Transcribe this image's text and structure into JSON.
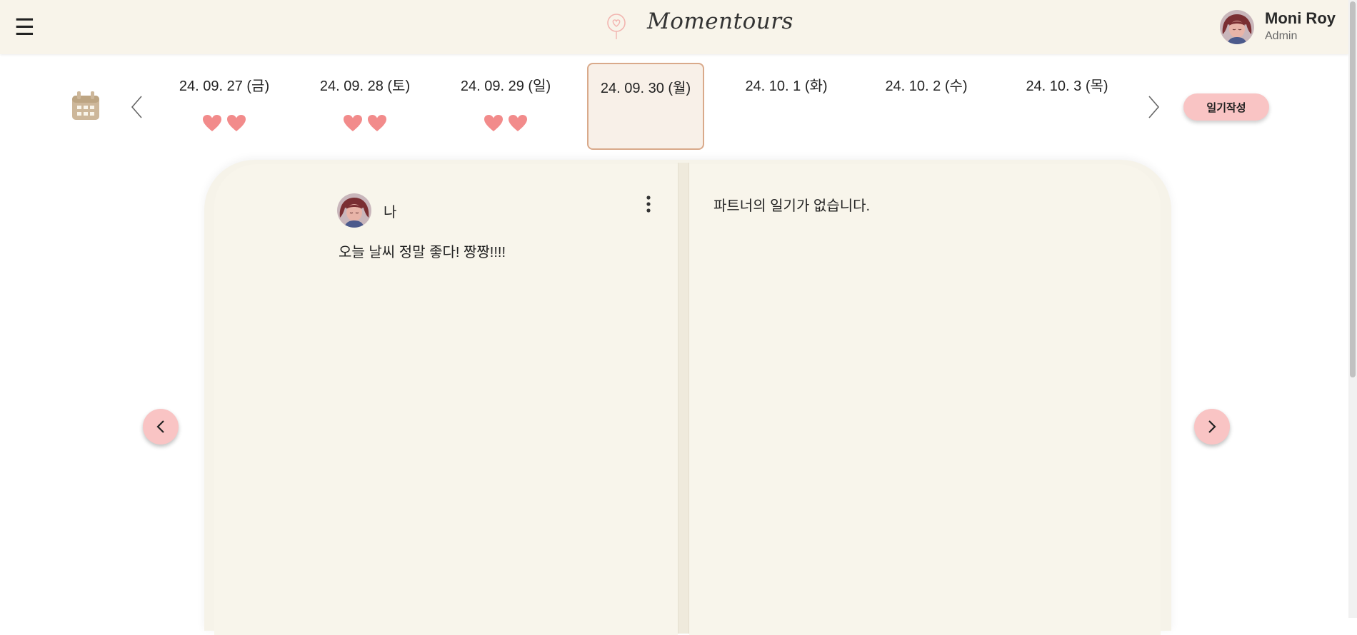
{
  "header": {
    "menu_icon": "☰",
    "brand": "Momentours",
    "user": {
      "name": "Moni Roy",
      "role": "Admin"
    }
  },
  "date_strip": {
    "dates": [
      {
        "label": "24. 09. 27 (금)",
        "hearts": 2,
        "selected": false
      },
      {
        "label": "24. 09. 28 (토)",
        "hearts": 2,
        "selected": false
      },
      {
        "label": "24. 09. 29 (일)",
        "hearts": 2,
        "selected": false
      },
      {
        "label": "24. 09. 30 (월)",
        "hearts": 0,
        "selected": true
      },
      {
        "label": "24. 10. 1 (화)",
        "hearts": 0,
        "selected": false
      },
      {
        "label": "24. 10. 2 (수)",
        "hearts": 0,
        "selected": false
      },
      {
        "label": "24. 10. 3 (목)",
        "hearts": 0,
        "selected": false
      }
    ],
    "write_button": "일기작성"
  },
  "diary": {
    "my_entry": {
      "author": "나",
      "text": "오늘 날씨 정말 좋다! 짱짱!!!!"
    },
    "partner_empty": "파트너의 일기가 없습니다."
  },
  "colors": {
    "header_bg": "#f8f4ea",
    "heart": "#f28b8b",
    "button_pink": "#f9c4c4",
    "selected_border": "#d9a98a",
    "calendar_icon": "#cdb79a",
    "page_bg": "#f8f5eb"
  },
  "icons": [
    "hamburger-menu-icon",
    "balloon-heart-logo-icon",
    "calendar-icon",
    "chevron-left-icon",
    "chevron-right-icon",
    "heart-icon",
    "more-vertical-icon"
  ]
}
